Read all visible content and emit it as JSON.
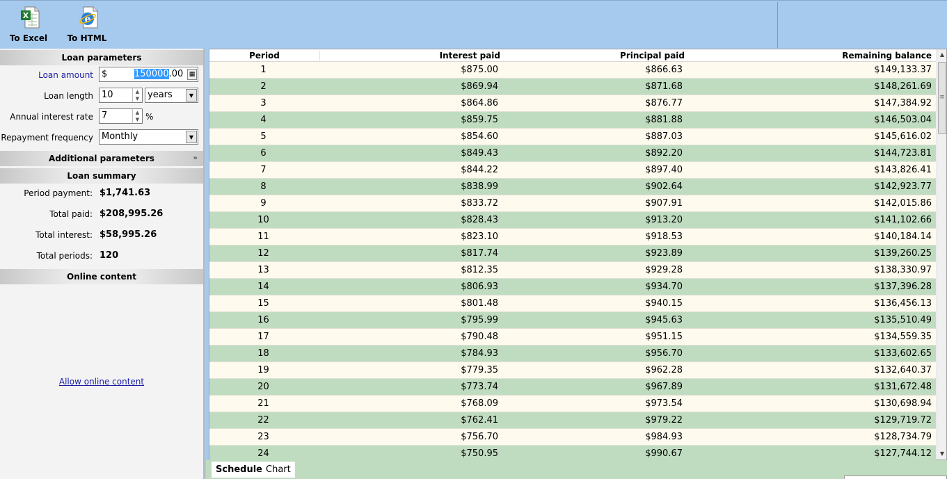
{
  "toolbar": {
    "excel_label": "To Excel",
    "html_label": "To HTML"
  },
  "loan_parameters": {
    "title": "Loan parameters",
    "loan_amount_label": "Loan amount",
    "loan_amount_currency": "$",
    "loan_amount_selected": "150000",
    "loan_amount_suffix": ".00",
    "loan_length_label": "Loan length",
    "loan_length_value": "10",
    "loan_length_unit": "years",
    "interest_rate_label": "Annual interest rate",
    "interest_rate_value": "7",
    "interest_rate_unit": "%",
    "frequency_label": "Repayment frequency",
    "frequency_value": "Monthly"
  },
  "additional_parameters": {
    "title": "Additional parameters"
  },
  "loan_summary": {
    "title": "Loan summary",
    "period_payment_label": "Period payment:",
    "period_payment_value": "$1,741.63",
    "total_paid_label": "Total paid:",
    "total_paid_value": "$208,995.26",
    "total_interest_label": "Total interest:",
    "total_interest_value": "$58,995.26",
    "total_periods_label": "Total periods:",
    "total_periods_value": "120"
  },
  "online_content": {
    "title": "Online content",
    "link": "Allow online content"
  },
  "schedule": {
    "headers": [
      "Period",
      "Interest paid",
      "Principal paid",
      "Remaining balance"
    ],
    "rows": [
      [
        "1",
        "$875.00",
        "$866.63",
        "$149,133.37"
      ],
      [
        "2",
        "$869.94",
        "$871.68",
        "$148,261.69"
      ],
      [
        "3",
        "$864.86",
        "$876.77",
        "$147,384.92"
      ],
      [
        "4",
        "$859.75",
        "$881.88",
        "$146,503.04"
      ],
      [
        "5",
        "$854.60",
        "$887.03",
        "$145,616.02"
      ],
      [
        "6",
        "$849.43",
        "$892.20",
        "$144,723.81"
      ],
      [
        "7",
        "$844.22",
        "$897.40",
        "$143,826.41"
      ],
      [
        "8",
        "$838.99",
        "$902.64",
        "$142,923.77"
      ],
      [
        "9",
        "$833.72",
        "$907.91",
        "$142,015.86"
      ],
      [
        "10",
        "$828.43",
        "$913.20",
        "$141,102.66"
      ],
      [
        "11",
        "$823.10",
        "$918.53",
        "$140,184.14"
      ],
      [
        "12",
        "$817.74",
        "$923.89",
        "$139,260.25"
      ],
      [
        "13",
        "$812.35",
        "$929.28",
        "$138,330.97"
      ],
      [
        "14",
        "$806.93",
        "$934.70",
        "$137,396.28"
      ],
      [
        "15",
        "$801.48",
        "$940.15",
        "$136,456.13"
      ],
      [
        "16",
        "$795.99",
        "$945.63",
        "$135,510.49"
      ],
      [
        "17",
        "$790.48",
        "$951.15",
        "$134,559.35"
      ],
      [
        "18",
        "$784.93",
        "$956.70",
        "$133,602.65"
      ],
      [
        "19",
        "$779.35",
        "$962.28",
        "$132,640.37"
      ],
      [
        "20",
        "$773.74",
        "$967.89",
        "$131,672.48"
      ],
      [
        "21",
        "$768.09",
        "$973.54",
        "$130,698.94"
      ],
      [
        "22",
        "$762.41",
        "$979.22",
        "$129,719.72"
      ],
      [
        "23",
        "$756.70",
        "$984.93",
        "$128,734.79"
      ],
      [
        "24",
        "$750.95",
        "$990.67",
        "$127,744.12"
      ]
    ]
  },
  "tabs": [
    "Schedule",
    "Chart"
  ],
  "colors": {
    "toolbar_bg": "#a6c9ee",
    "row_odd": "#fefbee",
    "row_even": "#c0dcc0",
    "link": "#1a1aa6"
  }
}
